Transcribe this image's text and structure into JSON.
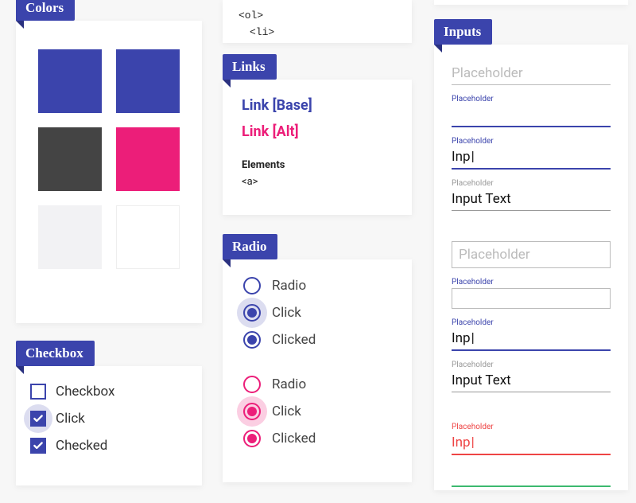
{
  "colors": {
    "title": "Colors",
    "swatches": [
      "#3b44ac",
      "#3b44ac",
      "#444444",
      "#ec1e79",
      "#f2f2f4",
      "#ffffff"
    ]
  },
  "checkbox": {
    "title": "Checkbox",
    "items": [
      {
        "label": "Checkbox",
        "state": "empty"
      },
      {
        "label": "Click",
        "state": "click"
      },
      {
        "label": "Checked",
        "state": "checked"
      }
    ]
  },
  "code_snippet": {
    "lines": [
      "<ol>",
      "<li>"
    ]
  },
  "links": {
    "title": "Links",
    "base": "Link [Base]",
    "alt": "Link [Alt]",
    "elements_heading": "Elements",
    "elements_tag": "<a>"
  },
  "radio": {
    "title": "Radio",
    "primary": [
      {
        "label": "Radio",
        "state": "empty"
      },
      {
        "label": "Click",
        "state": "click"
      },
      {
        "label": "Clicked",
        "state": "clicked"
      }
    ],
    "alt": [
      {
        "label": "Radio",
        "state": "empty"
      },
      {
        "label": "Click",
        "state": "click"
      },
      {
        "label": "Clicked",
        "state": "clicked"
      }
    ]
  },
  "inputs": {
    "title": "Inputs",
    "set1": [
      {
        "variant": "empty",
        "placeholder": "Placeholder"
      },
      {
        "variant": "tiny-focus",
        "floatlabel": "Placeholder"
      },
      {
        "variant": "filled-focus",
        "floatlabel": "Placeholder",
        "value": "Inp"
      },
      {
        "variant": "filled-static",
        "floatlabel": "Placeholder",
        "value": "Input Text"
      }
    ],
    "set2": [
      {
        "variant": "boxed-empty",
        "placeholder": "Placeholder"
      },
      {
        "variant": "boxed-blue",
        "floatlabel": "Placeholder"
      },
      {
        "variant": "filled-focus",
        "floatlabel": "Placeholder",
        "value": "Inp"
      },
      {
        "variant": "filled-static",
        "floatlabel": "Placeholder",
        "value": "Input Text"
      }
    ],
    "set3": [
      {
        "variant": "error",
        "floatlabel": "Placeholder",
        "value": "Inp"
      },
      {
        "variant": "success"
      }
    ]
  },
  "palette": {
    "primary": "#3b44ac",
    "accent": "#ec1e79",
    "dark": "#444444",
    "error": "#e44",
    "success": "#3cb96f"
  }
}
